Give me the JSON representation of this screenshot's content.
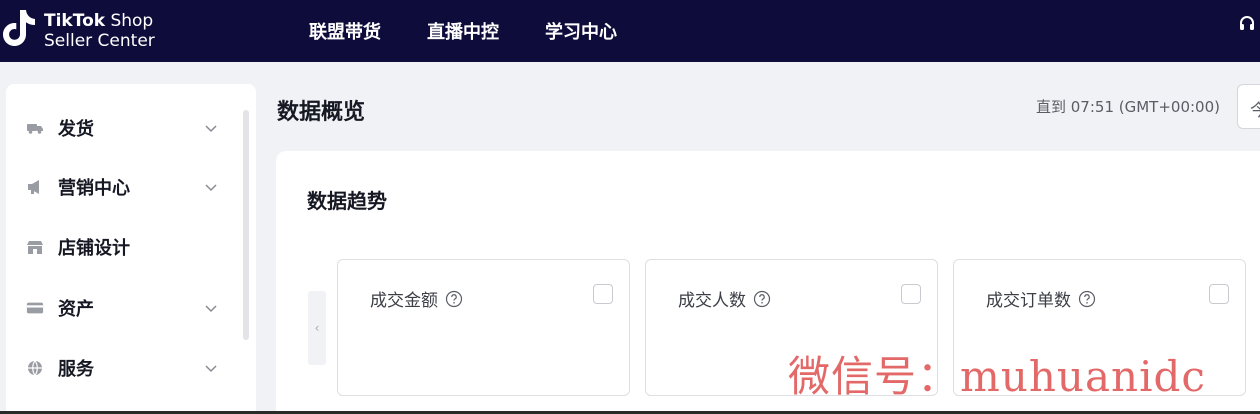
{
  "brand": {
    "line1_bold": "TikTok",
    "line1_rest": " Shop",
    "line2": "Seller Center"
  },
  "nav": [
    {
      "label": "联盟带货"
    },
    {
      "label": "直播中控"
    },
    {
      "label": "学习中心"
    }
  ],
  "sidebar": {
    "items": [
      {
        "label": "发货",
        "icon": "truck-icon",
        "expandable": true
      },
      {
        "label": "营销中心",
        "icon": "megaphone-icon",
        "expandable": true
      },
      {
        "label": "店铺设计",
        "icon": "store-icon",
        "expandable": false
      },
      {
        "label": "资产",
        "icon": "card-icon",
        "expandable": true
      },
      {
        "label": "服务",
        "icon": "globe-icon",
        "expandable": true
      }
    ]
  },
  "page": {
    "title": "数据概览",
    "updated_text": "直到 07:51 (GMT+00:00)",
    "date_picker_value": "今"
  },
  "trend": {
    "title": "数据趋势",
    "prev_glyph": "‹",
    "cards": [
      {
        "label": "成交金额",
        "checked": false
      },
      {
        "label": "成交人数",
        "checked": false
      },
      {
        "label": "成交订单数",
        "checked": false
      }
    ]
  },
  "watermark": "微信号：muhuanidc",
  "colors": {
    "topbar": "#0e0c3b",
    "page_bg": "#f1f2f5",
    "watermark": "#e36969"
  }
}
